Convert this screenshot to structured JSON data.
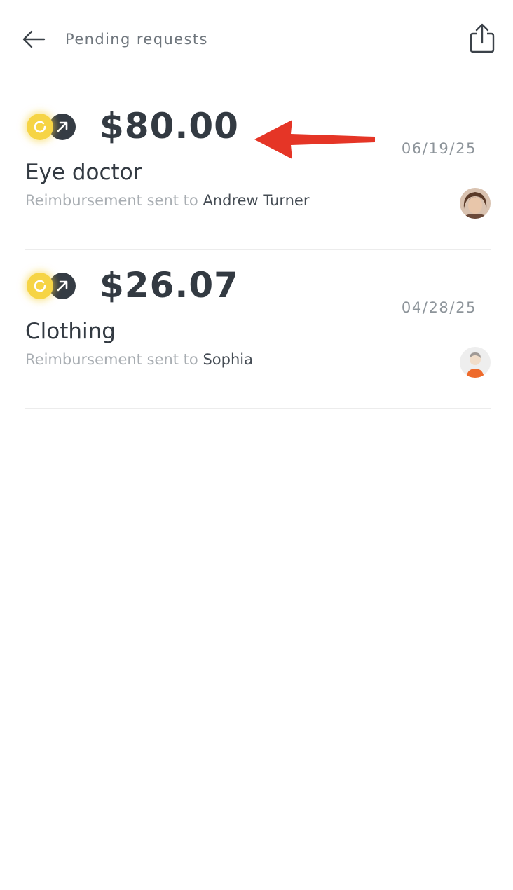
{
  "header": {
    "title": "Pending requests",
    "back_icon": "arrow-left-icon",
    "share_icon": "share-icon"
  },
  "requests": [
    {
      "amount": "$80.00",
      "date": "06/19/25",
      "title": "Eye doctor",
      "subtitle_prefix": "Reimbursement sent to",
      "recipient": "Andrew Turner",
      "status": "pending",
      "direction": "sent",
      "avatar": "photo-avatar"
    },
    {
      "amount": "$26.07",
      "date": "04/28/25",
      "title": "Clothing",
      "subtitle_prefix": "Reimbursement sent to",
      "recipient": "Sophia",
      "status": "pending",
      "direction": "sent",
      "avatar": "default-person-avatar"
    }
  ],
  "colors": {
    "pending": "#f6d445",
    "sent": "#353c44",
    "annotation": "#e53526",
    "divider": "#ececec"
  }
}
